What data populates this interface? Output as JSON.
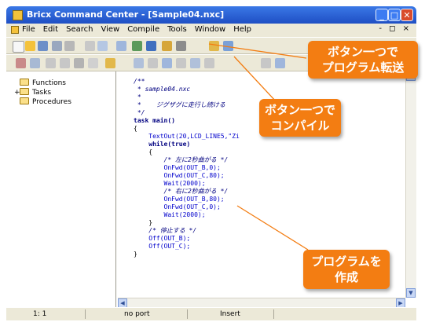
{
  "window": {
    "title": "Bricx Command Center - [Sample04.nxc]",
    "controls": [
      "_",
      "□",
      "✕"
    ]
  },
  "menu": {
    "items": [
      "File",
      "Edit",
      "Search",
      "View",
      "Compile",
      "Tools",
      "Window",
      "Help"
    ],
    "right": "- ◻ ×"
  },
  "sidebar": {
    "items": [
      {
        "label": "Functions",
        "expander": ""
      },
      {
        "label": "Tasks",
        "expander": "+"
      },
      {
        "label": "Procedures",
        "expander": ""
      }
    ]
  },
  "editor": {
    "lines": [
      {
        "text": "/**",
        "cls": "c-cm"
      },
      {
        "text": " * sample04.nxc",
        "cls": "c-cm"
      },
      {
        "text": " *",
        "cls": "c-cm"
      },
      {
        "text": " *    ジグザグに走行し続ける",
        "cls": "c-cm"
      },
      {
        "text": " */",
        "cls": "c-cm"
      },
      {
        "text": "task main()",
        "cls": "c-kw"
      },
      {
        "text": "{",
        "cls": "c-blk"
      },
      {
        "text": "    TextOut(20,LCD_LINE5,\"Zi",
        "cls": "c-fn"
      },
      {
        "text": "    while(true)",
        "cls": "c-kw"
      },
      {
        "text": "    {",
        "cls": "c-blk"
      },
      {
        "text": "        /* 左に2秒曲がる */",
        "cls": "c-cm"
      },
      {
        "text": "        OnFwd(OUT_B,0);",
        "cls": "c-fn"
      },
      {
        "text": "        OnFwd(OUT_C,80);",
        "cls": "c-fn"
      },
      {
        "text": "        Wait(2000);",
        "cls": "c-fn"
      },
      {
        "text": "        /* 右に2秒曲がる */",
        "cls": "c-cm"
      },
      {
        "text": "        OnFwd(OUT_B,80);",
        "cls": "c-fn"
      },
      {
        "text": "        OnFwd(OUT_C,0);",
        "cls": "c-fn"
      },
      {
        "text": "        Wait(2000);",
        "cls": "c-fn"
      },
      {
        "text": "    }",
        "cls": "c-blk"
      },
      {
        "text": "    /* 停止する */",
        "cls": "c-cm"
      },
      {
        "text": "    Off(OUT_B);",
        "cls": "c-fn"
      },
      {
        "text": "    Off(OUT_C);",
        "cls": "c-fn"
      },
      {
        "text": "}",
        "cls": "c-blk"
      }
    ]
  },
  "status": {
    "position": "1: 1",
    "mode": "no port",
    "insert": "Insert"
  },
  "callouts": {
    "transfer": [
      "ボタン一つで",
      "プログラム転送"
    ],
    "compile": [
      "ボタン一つで",
      "コンパイル"
    ],
    "create": [
      "プログラムを",
      "作成"
    ]
  },
  "colors": {
    "callout": "#f37d12",
    "titlebar": "#1f4fc4"
  }
}
